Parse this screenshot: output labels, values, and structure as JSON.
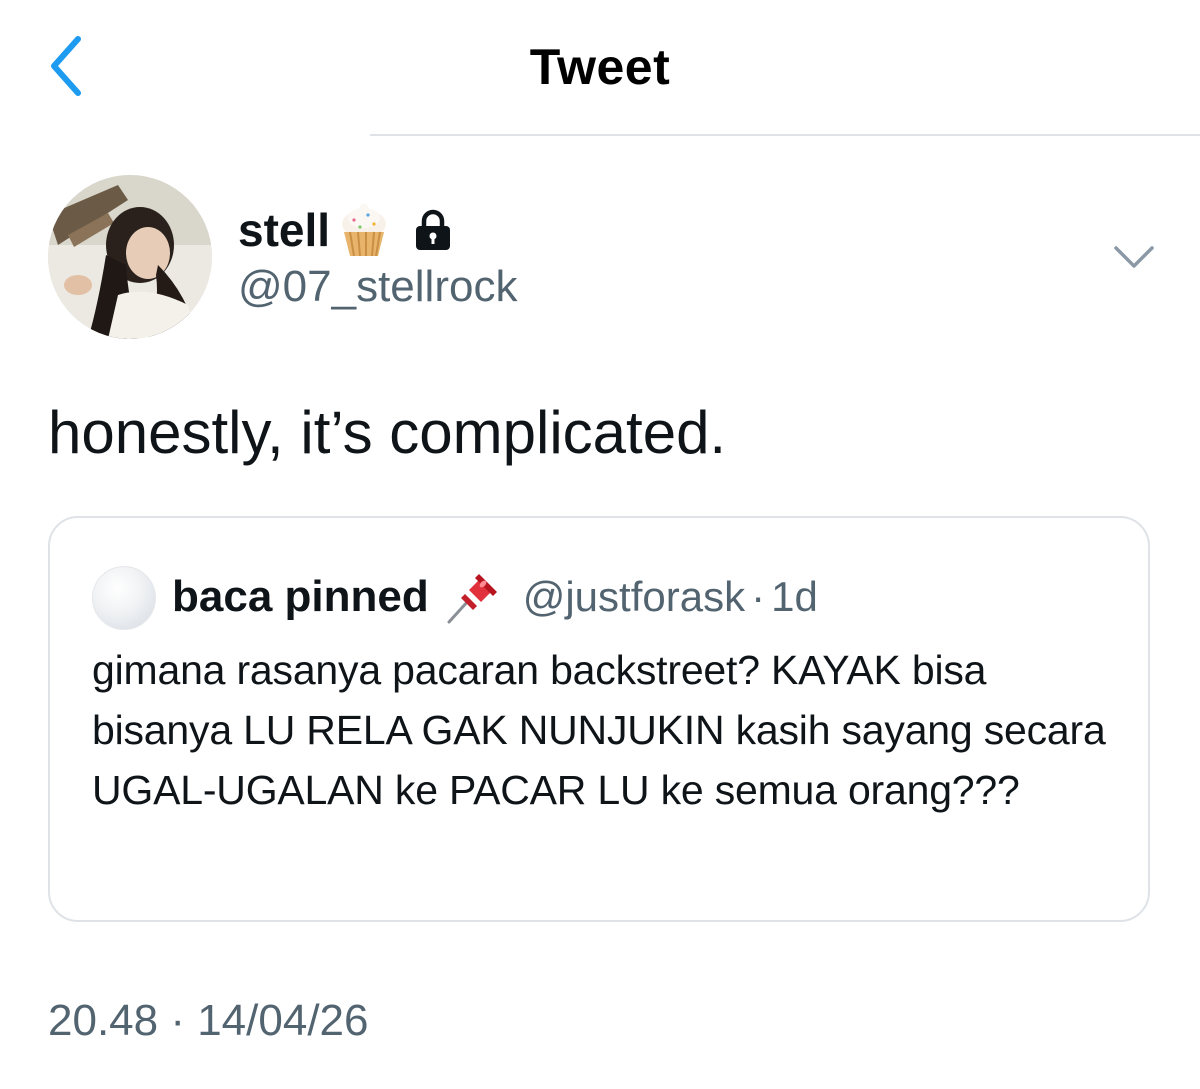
{
  "header": {
    "title": "Tweet",
    "back_icon": "chevron-left-icon"
  },
  "author": {
    "display_name": "stell",
    "name_emoji": "cupcake-icon",
    "protected_icon": "lock-icon",
    "handle": "@07_stellrock",
    "menu_icon": "chevron-down-icon"
  },
  "tweet": {
    "text": "honestly, it’s complicated.",
    "timestamp": "20.48 · 14/04/26"
  },
  "quoted_tweet": {
    "display_name": "baca pinned",
    "name_emoji": "pushpin-icon",
    "handle": "@justforask",
    "separator": "·",
    "time": "1d",
    "text": "gimana rasanya pacaran backstreet? KAYAK bisa bisanya LU RELA GAK NUNJUKIN kasih sayang secara UGAL-UGALAN ke PACAR LU ke semua orang???"
  },
  "colors": {
    "accent": "#1d9bf0",
    "text_primary": "#0f1419",
    "text_secondary": "#536471",
    "border": "#dfe3e7"
  }
}
